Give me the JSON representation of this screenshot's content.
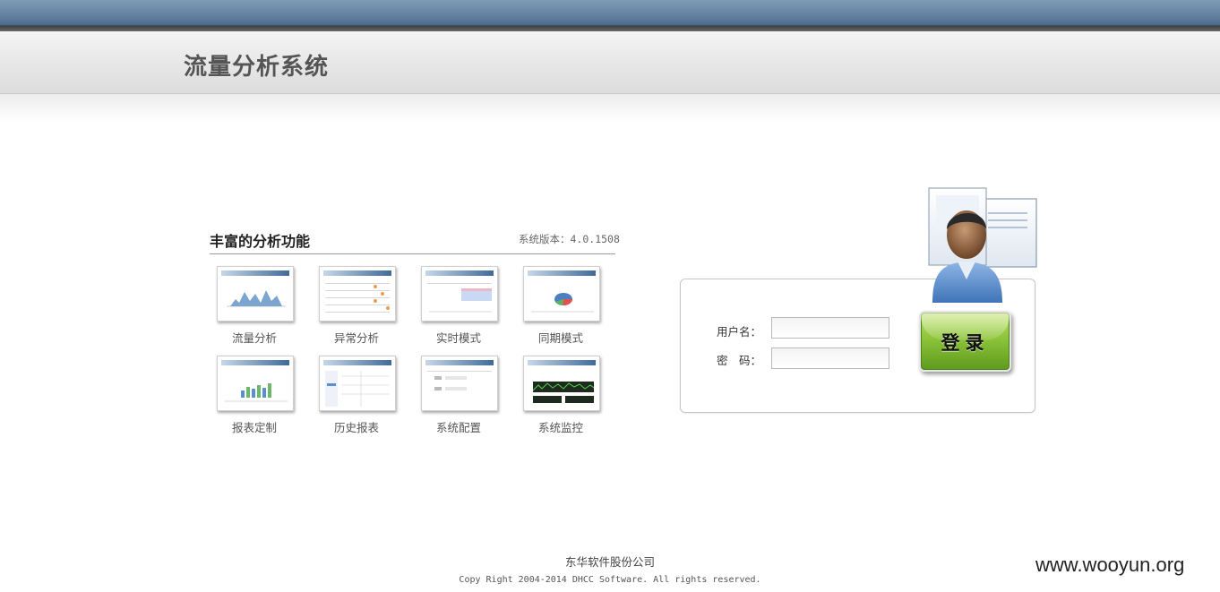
{
  "header": {
    "title": "流量分析系统"
  },
  "features": {
    "title": "丰富的分析功能",
    "version": "系统版本：4.0.1508",
    "items": [
      {
        "label": "流量分析",
        "icon": "traffic-chart-thumbnail"
      },
      {
        "label": "异常分析",
        "icon": "anomaly-table-thumbnail"
      },
      {
        "label": "实时模式",
        "icon": "realtime-thumbnail"
      },
      {
        "label": "同期模式",
        "icon": "pie-chart-thumbnail"
      },
      {
        "label": "报表定制",
        "icon": "report-bar-thumbnail"
      },
      {
        "label": "历史报表",
        "icon": "history-table-thumbnail"
      },
      {
        "label": "系统配置",
        "icon": "config-form-thumbnail"
      },
      {
        "label": "系统监控",
        "icon": "monitor-graph-thumbnail"
      }
    ]
  },
  "login": {
    "username_label": "用户名：",
    "password_label": "密　码：",
    "username_value": "",
    "password_value": "",
    "button_label": "登录",
    "accent_color": "#8cc43a"
  },
  "footer": {
    "company": "东华软件股份公司",
    "copyright": "Copy Right 2004-2014 DHCC Software. All rights reserved."
  },
  "watermark": "www.wooyun.org"
}
